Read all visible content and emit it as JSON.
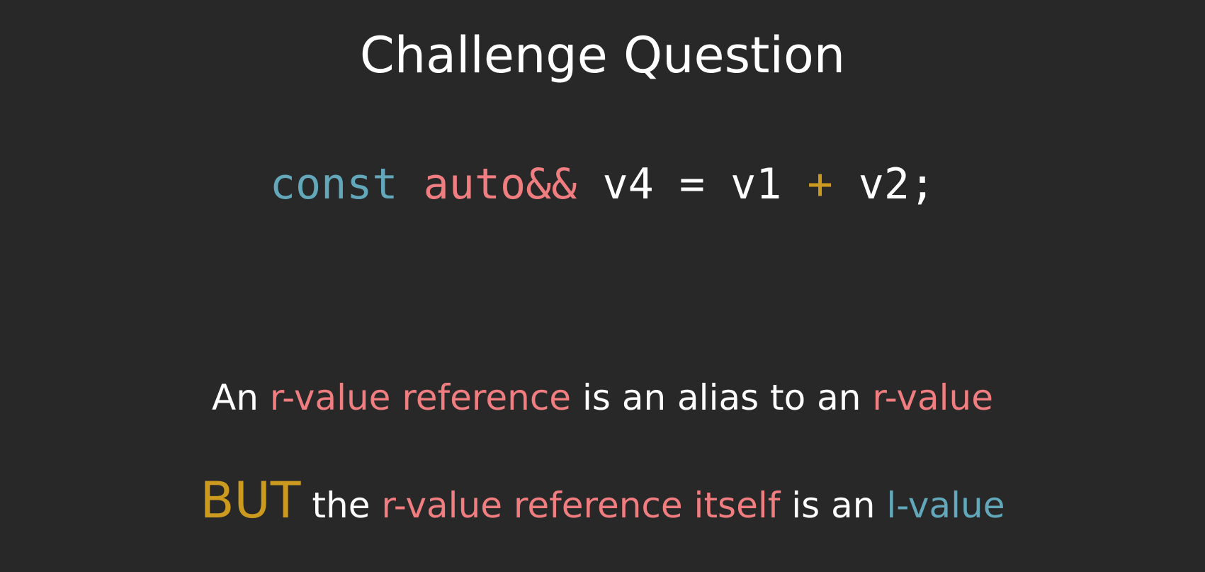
{
  "slide": {
    "title": "Challenge Question"
  },
  "code": {
    "keyword": "const",
    "type": "auto&&",
    "lhs": "v4 = v1",
    "operator": "+",
    "rhs": "v2;"
  },
  "statement_1": {
    "prefix": "An",
    "term_1": "r-value reference",
    "middle": "is an alias to an",
    "term_2": "r-value"
  },
  "statement_2": {
    "emphasis": "BUT",
    "word_the": "the",
    "term_1": "r-value reference itself",
    "middle": "is an",
    "term_2": "l-value"
  },
  "colors": {
    "background": "#282828",
    "text": "#ffffff",
    "highlight_red": "#f07d80",
    "highlight_blue": "#62a8ba",
    "highlight_gold": "#cb9a1e"
  }
}
